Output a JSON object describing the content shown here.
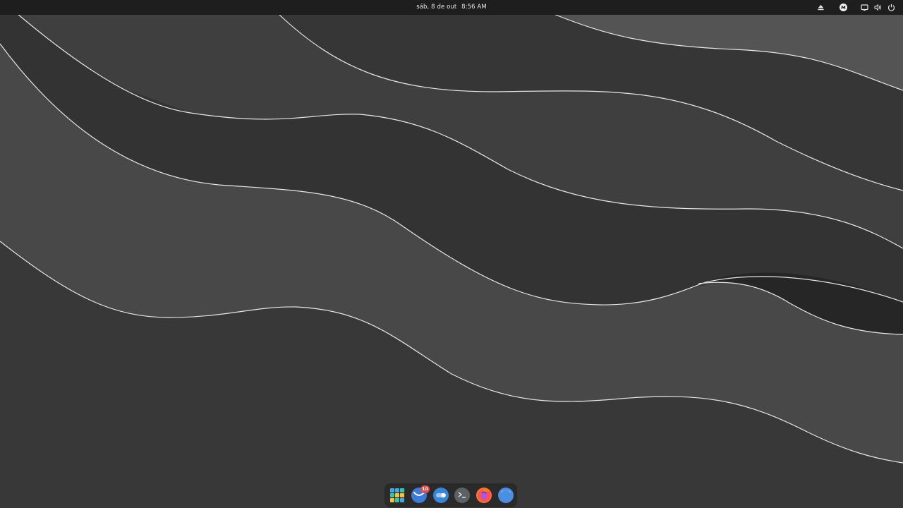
{
  "top_panel": {
    "date": "sáb, 8 de out",
    "time": "8:56 AM",
    "tray_icons": [
      "eject-icon",
      "mastodon-icon",
      "display-icon",
      "volume-icon",
      "power-icon"
    ]
  },
  "dock": {
    "items": [
      {
        "name": "app-grid-icon"
      },
      {
        "name": "mail-app-icon",
        "badge": "10"
      },
      {
        "name": "settings-toggle-app-icon"
      },
      {
        "name": "terminal-app-icon"
      },
      {
        "name": "firefox-app-icon"
      },
      {
        "name": "files-app-icon"
      }
    ]
  },
  "colors": {
    "panel_bg": "#1e1e1e",
    "wallpaper_dark": "#333333",
    "wallpaper_mid": "#3f3f3f",
    "wallpaper_light": "#484848",
    "wallpaper_lightest": "#545454",
    "wave_stroke": "#e6e6e6",
    "badge": "#e24c4c"
  }
}
